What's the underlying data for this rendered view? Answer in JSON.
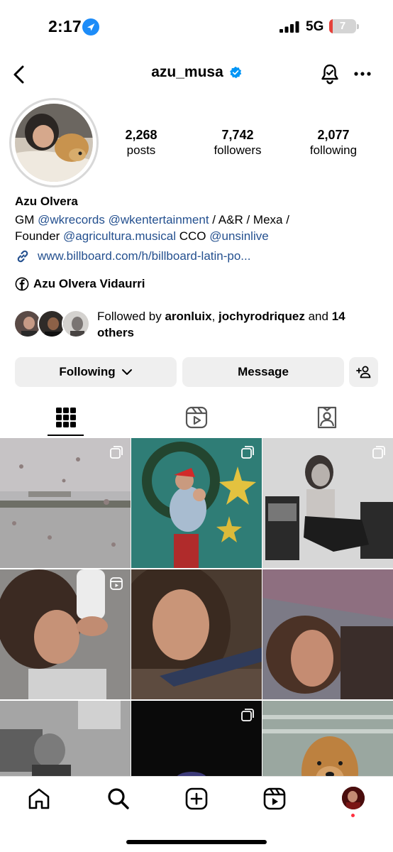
{
  "status_bar": {
    "time": "2:17",
    "network": "5G",
    "battery_level": "7",
    "battery_fraction": 0.07
  },
  "header": {
    "username": "azu_musa",
    "back_icon": "chevron-left-icon",
    "verified_icon": "verified-badge-icon",
    "bell_icon": "bell-icon",
    "more_icon": "more-dots-icon"
  },
  "profile": {
    "stats": [
      {
        "value": "2,268",
        "label": "posts"
      },
      {
        "value": "7,742",
        "label": "followers"
      },
      {
        "value": "2,077",
        "label": "following"
      }
    ],
    "full_name": "Azu Olvera",
    "bio": {
      "line1_prefix": "GM ",
      "mention1": "@wkrecords",
      "space": " ",
      "mention2": "@wkentertainment",
      "line1_suffix": " / A&R / Mexa /",
      "line2_prefix": "Founder ",
      "mention3": "@agricultura.musical",
      "line2_mid": " CCO ",
      "mention4": "@unsinlive"
    },
    "link": "www.billboard.com/h/billboard-latin-po...",
    "facebook_name": "Azu Olvera Vidaurri"
  },
  "followed_by": {
    "prefix": "Followed by ",
    "user1": "aronluix",
    "sep": ", ",
    "user2": "jochyrodriquez",
    "and": " and ",
    "others": "14 others"
  },
  "actions": {
    "following_label": "Following",
    "message_label": "Message"
  },
  "tabs": [
    "posts-grid-icon",
    "reels-icon",
    "tagged-icon"
  ],
  "grid": {
    "posts": [
      {
        "kind": "carousel",
        "subject": "rainy window airport"
      },
      {
        "kind": "carousel",
        "subject": "christmas mother and child"
      },
      {
        "kind": "carousel",
        "subject": "black and white portrait"
      },
      {
        "kind": "reel",
        "subject": "selfie drinking"
      },
      {
        "kind": "photo",
        "subject": "close-up selfie"
      },
      {
        "kind": "photo",
        "subject": "lying selfie"
      },
      {
        "kind": "photo",
        "subject": "child black and white"
      },
      {
        "kind": "carousel",
        "subject": "dark moon"
      },
      {
        "kind": "photo",
        "subject": "golden retriever"
      }
    ]
  },
  "bottom_nav": [
    "home-icon",
    "search-icon",
    "create-icon",
    "reels-icon",
    "profile-avatar"
  ],
  "colors": {
    "link_blue": "#24508f",
    "verified_blue": "#0095f6",
    "button_gray": "#efefef",
    "notification_red": "#ff3040"
  }
}
